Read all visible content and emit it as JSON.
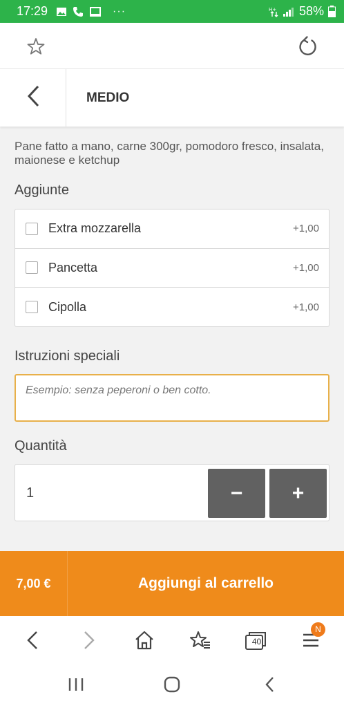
{
  "status_bar": {
    "time": "17:29",
    "notification_icons": [
      "image-icon",
      "phone-icon",
      "cast-icon",
      "more-dots-icon"
    ],
    "dots": "···",
    "network_icons": [
      "data-arrows-icon",
      "signal-icon"
    ],
    "battery_percent": "58%",
    "background": "#2db34a"
  },
  "browser_top": {
    "bookmark_icon": "star-outline-icon",
    "reload_icon": "reload-icon"
  },
  "header": {
    "back_icon": "chevron-left-icon",
    "title": "MEDIO"
  },
  "product": {
    "description": "Pane fatto a mano, carne 300gr, pomodoro fresco, insalata, maionese e ketchup"
  },
  "addons": {
    "label": "Aggiunte",
    "items": [
      {
        "name": "Extra mozzarella",
        "price": "+1,00",
        "checked": false
      },
      {
        "name": "Pancetta",
        "price": "+1,00",
        "checked": false
      },
      {
        "name": "Cipolla",
        "price": "+1,00",
        "checked": false
      }
    ]
  },
  "instructions": {
    "label": "Istruzioni speciali",
    "placeholder": "Esempio: senza peperoni o ben cotto.",
    "value": "",
    "border_color": "#e8b04a"
  },
  "quantity": {
    "label": "Quantità",
    "value": "1",
    "minus_label": "−",
    "plus_label": "+"
  },
  "cart": {
    "price": "7,00 €",
    "add_label": "Aggiungi al carrello",
    "background": "#ef8b1b"
  },
  "browser_bottom": {
    "icons": [
      "back-arrow-icon",
      "forward-arrow-icon",
      "home-icon",
      "bookmarks-icon",
      "tabs-icon",
      "menu-icon"
    ],
    "tabs_count": "40",
    "menu_badge": "N"
  },
  "system_nav": {
    "icons": [
      "recents-icon",
      "home-circle-icon",
      "system-back-icon"
    ]
  }
}
